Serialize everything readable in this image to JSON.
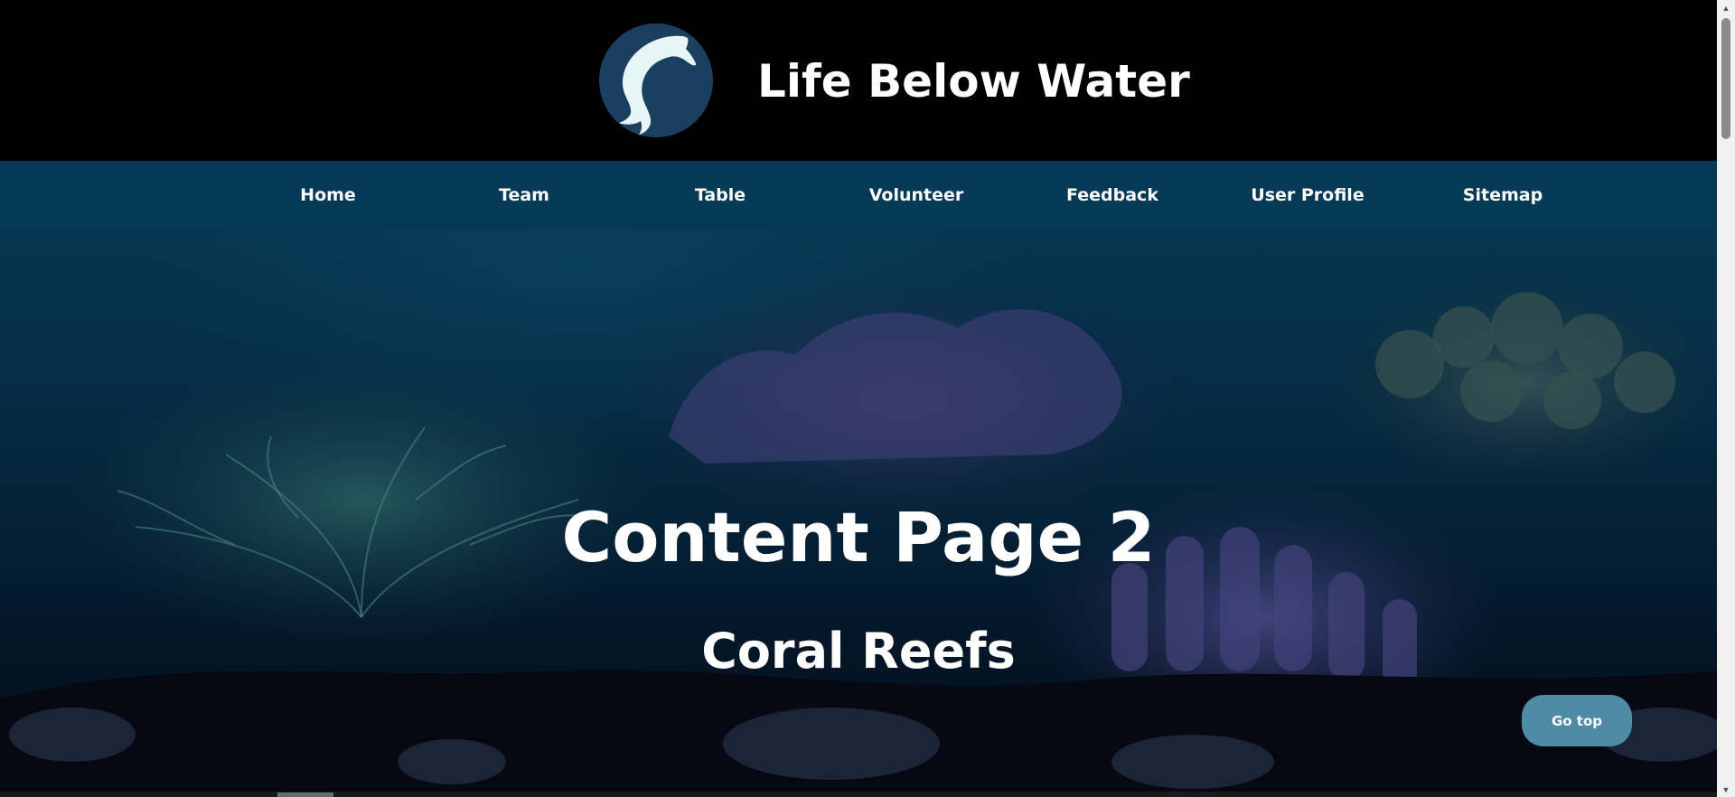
{
  "header": {
    "site_title": "Life Below Water",
    "logo_icon": "dolphin-icon"
  },
  "nav": {
    "items": [
      {
        "label": "Home"
      },
      {
        "label": "Team"
      },
      {
        "label": "Table"
      },
      {
        "label": "Volunteer"
      },
      {
        "label": "Feedback"
      },
      {
        "label": "User Profile"
      },
      {
        "label": "Sitemap"
      }
    ]
  },
  "hero": {
    "title": "Content Page 2",
    "subtitle": "Coral Reefs"
  },
  "go_top": {
    "label": "Go top"
  },
  "colors": {
    "header_bg": "#000000",
    "nav_bg": "#043a55",
    "logo_bg": "#1b3f5e",
    "go_top_bg": "#4f8ba5",
    "text": "#ffffff"
  }
}
